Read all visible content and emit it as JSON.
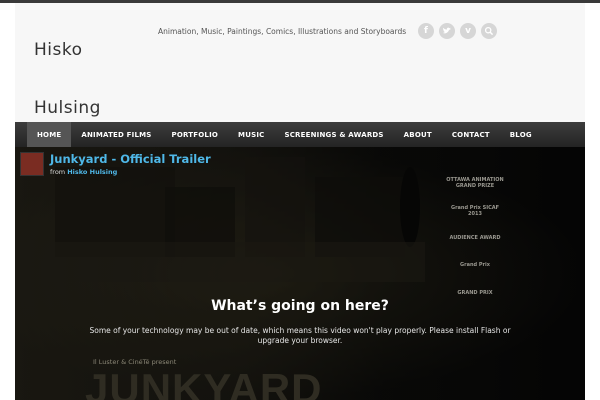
{
  "site": {
    "title_line1": "Hisko",
    "title_line2": "Hulsing",
    "tagline": "Animation, Music, Paintings, Comics, Illustrations and Storyboards"
  },
  "social": [
    {
      "icon": "facebook-icon",
      "glyph": "f"
    },
    {
      "icon": "twitter-icon",
      "glyph": ""
    },
    {
      "icon": "vimeo-icon",
      "glyph": "v"
    },
    {
      "icon": "search-icon",
      "glyph": ""
    }
  ],
  "nav": {
    "items": [
      {
        "label": "HOME",
        "active": true
      },
      {
        "label": "ANIMATED FILMS",
        "active": false
      },
      {
        "label": "PORTFOLIO",
        "active": false
      },
      {
        "label": "MUSIC",
        "active": false
      },
      {
        "label": "SCREENINGS & AWARDS",
        "active": false
      },
      {
        "label": "ABOUT",
        "active": false
      },
      {
        "label": "CONTACT",
        "active": false
      },
      {
        "label": "BLOG",
        "active": false
      }
    ]
  },
  "video": {
    "title": "Junkyard - Official Trailer",
    "from_prefix": "from",
    "author": "Hisko Hulsing",
    "message_title": "What’s going on here?",
    "message_text": "Some of your technology may be out of date, which means this video won't play properly. Please install Flash or upgrade your browser.",
    "presents": "Il Luster & CinéTé present",
    "film_title": "JUNKYARD"
  },
  "laurels": [
    "OTTAWA ANIMATION GRAND PRIZE",
    "Grand Prix SICAF 2013",
    "AUDIENCE AWARD",
    "Grand Prix",
    "GRAND PRIX",
    "",
    ""
  ],
  "colors": {
    "accent_link": "#4fb8e8",
    "nav_bg": "#2e2e2e",
    "nav_active": "#555555",
    "header_bg": "#f7f7f7"
  }
}
